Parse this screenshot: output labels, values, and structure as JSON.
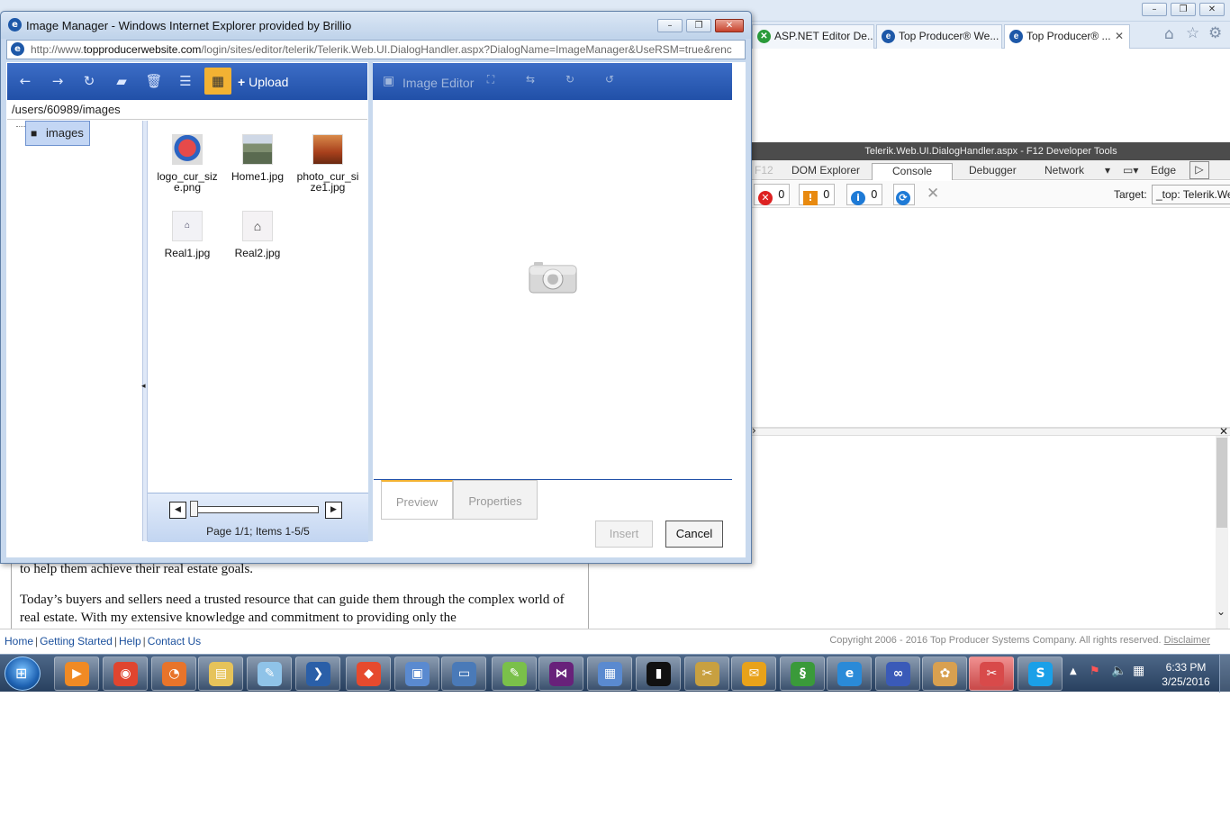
{
  "popup": {
    "title": "Image Manager - Windows Internet Explorer provided by Brillio",
    "url_prefix": "http://www.",
    "url_domain": "topproducerwebsite.com",
    "url_rest": "/login/sites/editor/telerik/Telerik.Web.UI.DialogHandler.aspx?DialogName=ImageManager&UseRSM=true&renc"
  },
  "file_manager": {
    "upload_label": "Upload",
    "path": "/users/60989/images",
    "tree_node": "images",
    "files": [
      {
        "name": "logo_cur_siz e.png",
        "color": "#d33a3a"
      },
      {
        "name": "Home1.jpg",
        "color": "#8a9a7a"
      },
      {
        "name": "photo_cur_si ze1.jpg",
        "color": "#b8562a"
      },
      {
        "name": "Real1.jpg",
        "color": "#e8e8f0"
      },
      {
        "name": "Real2.jpg",
        "color": "#f0eef0"
      }
    ],
    "pager_info": "Page 1/1; Items 1-5/5"
  },
  "editor": {
    "title": "Image Editor",
    "tabs": [
      "Preview",
      "Properties"
    ],
    "insert_label": "Insert",
    "cancel_label": "Cancel"
  },
  "browser_tabs": [
    {
      "label": "ASP.NET Editor De..."
    },
    {
      "label": "Top Producer® We..."
    },
    {
      "label": "Top Producer® ..."
    }
  ],
  "devtools": {
    "title": "Telerik.Web.UI.DialogHandler.aspx - F12 Developer Tools",
    "tabs": [
      "F12",
      "DOM Explorer",
      "Console",
      "Debugger",
      "Network"
    ],
    "mode": "Edge",
    "errors": "0",
    "warnings": "0",
    "info": "0",
    "target_label": "Target:",
    "target_value": "_top: Telerik.We"
  },
  "page_text": {
    "p1": "to help them achieve their real estate goals.",
    "p2": "Today’s buyers and sellers need a trusted resource that can guide them through the complex world of real estate. With my extensive knowledge and commitment to providing only the"
  },
  "footer": {
    "links": [
      "Home",
      "Getting Started",
      "Help",
      "Contact Us"
    ],
    "copyright": "Copyright 2006 - 2016 Top Producer Systems Company. All rights reserved.",
    "disclaimer": "Disclaimer"
  },
  "taskbar": {
    "time": "6:33 PM",
    "date": "3/25/2016",
    "apps": [
      "media-player",
      "chrome",
      "firefox",
      "explorer",
      "notepad",
      "powershell",
      "git",
      "network",
      "photos",
      "notepad-plus",
      "visual-studio",
      "remote-desktop",
      "cmd",
      "tools",
      "outlook",
      "link",
      "internet-explorer",
      "infinity",
      "paint",
      "snipping-tool",
      "skype"
    ]
  },
  "colors": {
    "toolbar_blue": "#2150a8",
    "active_yellow": "#f2b233"
  }
}
